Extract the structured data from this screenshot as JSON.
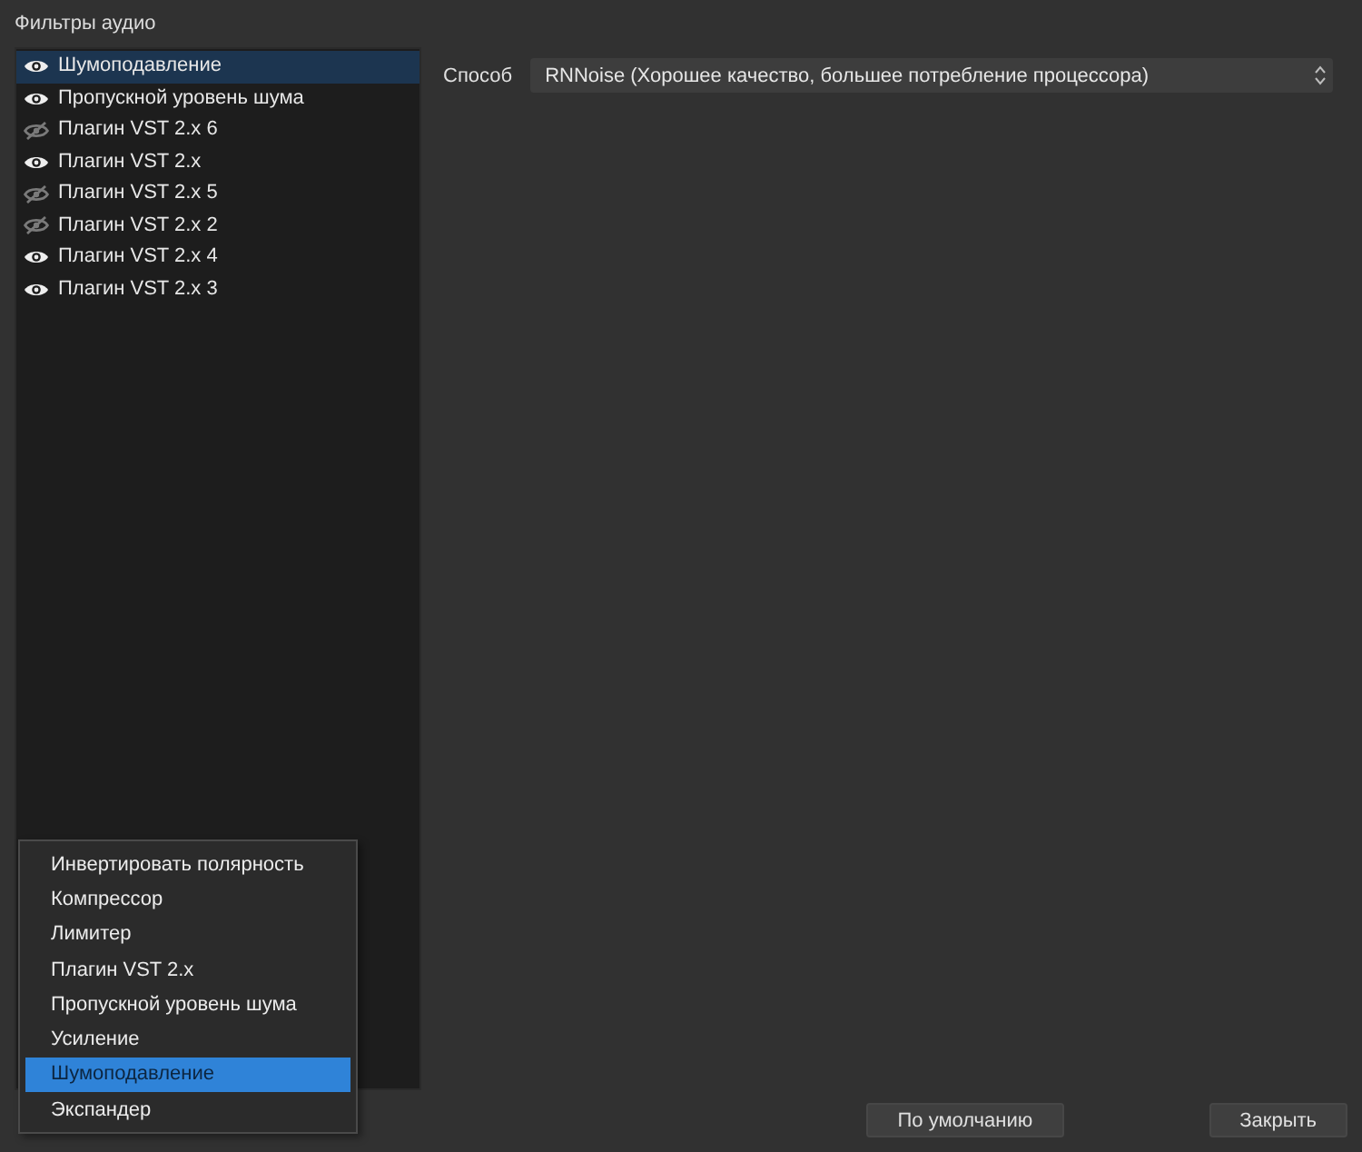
{
  "title": "Фильтры аудио",
  "filters": [
    {
      "name": "Шумоподавление",
      "visible": true,
      "selected": true
    },
    {
      "name": "Пропускной уровень шума",
      "visible": true,
      "selected": false
    },
    {
      "name": "Плагин VST 2.x 6",
      "visible": false,
      "selected": false
    },
    {
      "name": "Плагин VST 2.x",
      "visible": true,
      "selected": false
    },
    {
      "name": "Плагин VST 2.x 5",
      "visible": false,
      "selected": false
    },
    {
      "name": "Плагин VST 2.x 2",
      "visible": false,
      "selected": false
    },
    {
      "name": "Плагин VST 2.x 4",
      "visible": true,
      "selected": false
    },
    {
      "name": "Плагин VST 2.x 3",
      "visible": true,
      "selected": false
    }
  ],
  "properties": [
    {
      "label": "Способ",
      "value": "RNNoise (Хорошее качество, большее потребление процессора)"
    }
  ],
  "context_menu": [
    {
      "label": "Инвертировать полярность",
      "selected": false
    },
    {
      "label": "Компрессор",
      "selected": false
    },
    {
      "label": "Лимитер",
      "selected": false
    },
    {
      "label": "Плагин VST 2.x",
      "selected": false
    },
    {
      "label": "Пропускной уровень шума",
      "selected": false
    },
    {
      "label": "Усиление",
      "selected": false
    },
    {
      "label": "Шумоподавление",
      "selected": true
    },
    {
      "label": "Экспандер",
      "selected": false
    }
  ],
  "buttons": [
    "По умолчанию",
    "Закрыть"
  ]
}
